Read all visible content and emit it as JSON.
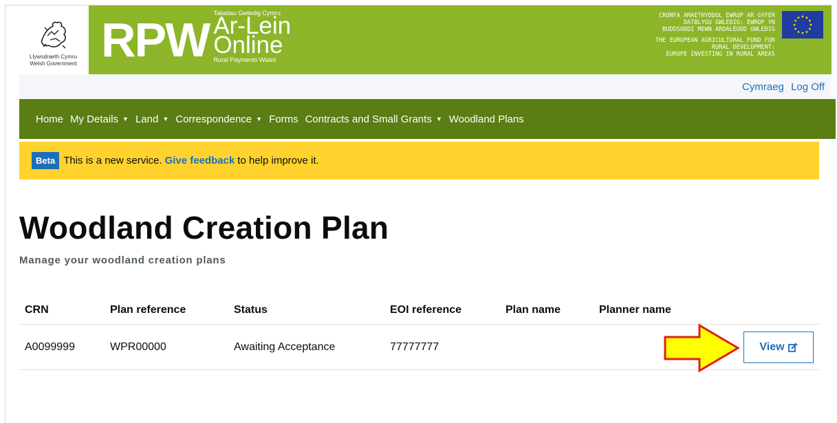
{
  "header": {
    "wg_line1": "Llywodraeth Cymru",
    "wg_line2": "Welsh Government",
    "rpw": "RPW",
    "arlein_top": "Taliadau Gwledig Cymru",
    "arlein_line1": "Ar-Lein",
    "arlein_line2": "Online",
    "arlein_bottom": "Rural Payments Wales",
    "fund_cy": [
      "CRONFA AMAETHYDDOL EWROP AR GYFER",
      "DATBLYGU GWLEDIG: EWROP YN",
      "BUDDSODDI MEWN ARDALEODD GWLEDIG"
    ],
    "fund_en": [
      "THE EUROPEAN AGRICULTURAL FUND FOR",
      "RURAL DEVELOPMENT:",
      "EUROPE INVESTING IN RURAL AREAS"
    ]
  },
  "utility": {
    "language": "Cymraeg",
    "logoff": "Log Off"
  },
  "nav": {
    "home": "Home",
    "my_details": "My Details",
    "land": "Land",
    "correspondence": "Correspondence",
    "forms": "Forms",
    "contracts": "Contracts and Small Grants",
    "woodland": "Woodland Plans"
  },
  "beta": {
    "tag": "Beta",
    "text_before": "This is a new service.",
    "link": "Give feedback",
    "text_after": "to help improve it."
  },
  "page": {
    "title": "Woodland Creation Plan",
    "subtitle": "Manage your woodland creation plans"
  },
  "table": {
    "headers": {
      "crn": "CRN",
      "plan_ref": "Plan reference",
      "status": "Status",
      "eoi": "EOI reference",
      "plan_name": "Plan name",
      "planner": "Planner name"
    },
    "rows": [
      {
        "crn": "A0099999",
        "plan_ref": "WPR00000",
        "status": "Awaiting Acceptance",
        "eoi": "77777777",
        "plan_name": "",
        "planner": "",
        "action": "View"
      }
    ]
  },
  "colors": {
    "header_green": "#8cb529",
    "nav_green": "#5a7d14",
    "beta_yellow": "#ffd22e",
    "link_blue": "#1d70b8",
    "arrow_fill": "#ffff00",
    "arrow_stroke": "#e0201b"
  }
}
